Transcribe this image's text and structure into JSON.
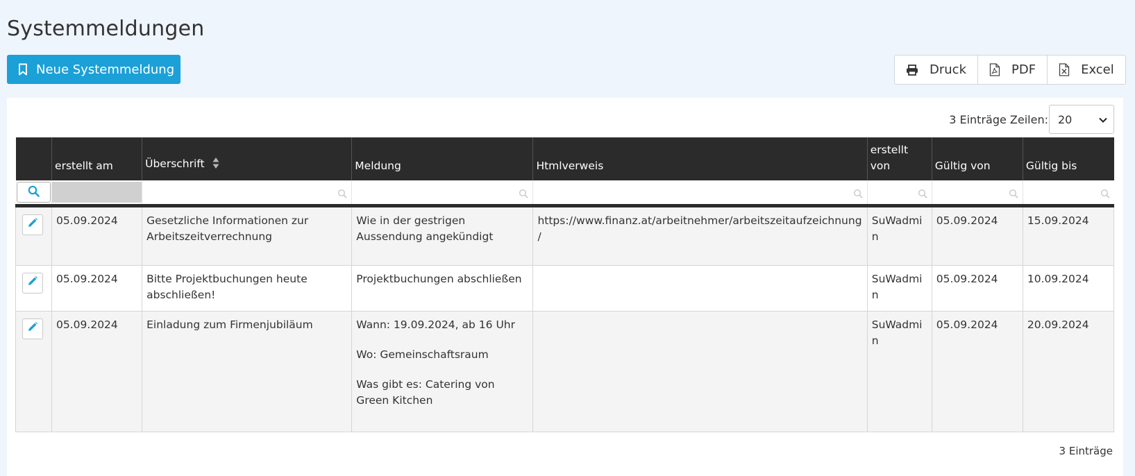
{
  "page": {
    "title": "Systemmeldungen"
  },
  "toolbar": {
    "new_button": "Neue Systemmeldung",
    "export": [
      {
        "label": "Druck",
        "icon": "print-icon"
      },
      {
        "label": "PDF",
        "icon": "pdf-file-icon"
      },
      {
        "label": "Excel",
        "icon": "excel-file-icon"
      }
    ]
  },
  "table_info": {
    "entries_rows_label": "3 Einträge Zeilen:",
    "rows_per_page": "20",
    "footer_count": "3 Einträge"
  },
  "table": {
    "columns": [
      "",
      "erstellt am",
      "Überschrift",
      "Meldung",
      "Htmlverweis",
      "erstellt von",
      "Gültig von",
      "Gültig bis"
    ],
    "sorted_column": "Überschrift",
    "rows": [
      {
        "erstellt_am": "05.09.2024",
        "ueberschrift": "Gesetzliche Informationen zur Arbeitszeitverrechnung",
        "meldung": [
          "Wie in der gestrigen Aussendung angekündigt"
        ],
        "htmlverweis": "https://www.finanz.at/arbeitnehmer/arbeitszeitaufzeichnung/",
        "erstellt_von": "SuWadmin",
        "gueltig_von": "05.09.2024",
        "gueltig_bis": "15.09.2024"
      },
      {
        "erstellt_am": "05.09.2024",
        "ueberschrift": "Bitte Projektbuchungen heute abschließen!",
        "meldung": [
          "Projektbuchungen abschließen"
        ],
        "htmlverweis": "",
        "erstellt_von": "SuWadmin",
        "gueltig_von": "05.09.2024",
        "gueltig_bis": "10.09.2024"
      },
      {
        "erstellt_am": "05.09.2024",
        "ueberschrift": "Einladung zum Firmenjubiläum",
        "meldung": [
          "Wann: 19.09.2024, ab 16 Uhr",
          "Wo: Gemeinschaftsraum",
          "Was gibt es: Catering von Green Kitchen"
        ],
        "htmlverweis": "",
        "erstellt_von": "SuWadmin",
        "gueltig_von": "05.09.2024",
        "gueltig_bis": "20.09.2024"
      }
    ]
  },
  "colors": {
    "accent": "#1ba0d7",
    "header_bg": "#2b2b2b",
    "page_bg": "#eef5fc"
  }
}
